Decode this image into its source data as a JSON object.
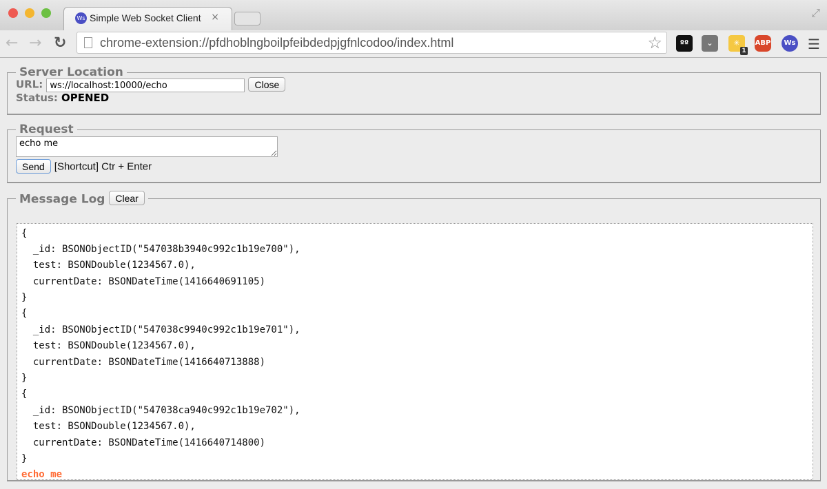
{
  "browser": {
    "tab_title": "Simple Web Socket Client",
    "tab_close": "×",
    "address": "chrome-extension://pfdhoblngboilpfeibdedpjgfnlcodoo/index.html",
    "favicon_text": "Ws",
    "extensions": [
      {
        "icon": "owl-icon",
        "color": "#111111"
      },
      {
        "icon": "pocket-icon",
        "color": "#777777"
      },
      {
        "icon": "yellow-extension-icon",
        "color": "#f5c842",
        "badge": "1"
      },
      {
        "icon": "adblock-plus-icon",
        "color": "#d9472b",
        "text": "ABP"
      },
      {
        "icon": "websocket-client-icon",
        "color": "#4a4fc4",
        "text": "Ws"
      }
    ]
  },
  "server": {
    "legend": "Server Location",
    "url_label": "URL:",
    "url_value": "ws://localhost:10000/echo",
    "close_label": "Close",
    "status_label": "Status:",
    "status_value": "OPENED"
  },
  "request": {
    "legend": "Request",
    "text": "echo me",
    "send_label": "Send",
    "shortcut": "[Shortcut] Ctr + Enter"
  },
  "log": {
    "legend": "Message Log",
    "clear_label": "Clear",
    "lines": [
      "{",
      "  _id: BSONObjectID(\"547038b3940c992c1b19e700\"),",
      "  test: BSONDouble(1234567.0),",
      "  currentDate: BSONDateTime(1416640691105)",
      "}",
      "{",
      "  _id: BSONObjectID(\"547038c9940c992c1b19e701\"),",
      "  test: BSONDouble(1234567.0),",
      "  currentDate: BSONDateTime(1416640713888)",
      "}",
      "{",
      "  _id: BSONObjectID(\"547038ca940c992c1b19e702\"),",
      "  test: BSONDouble(1234567.0),",
      "  currentDate: BSONDateTime(1416640714800)",
      "}"
    ],
    "sent": "echo me",
    "sent_color": "#ff6a33"
  }
}
